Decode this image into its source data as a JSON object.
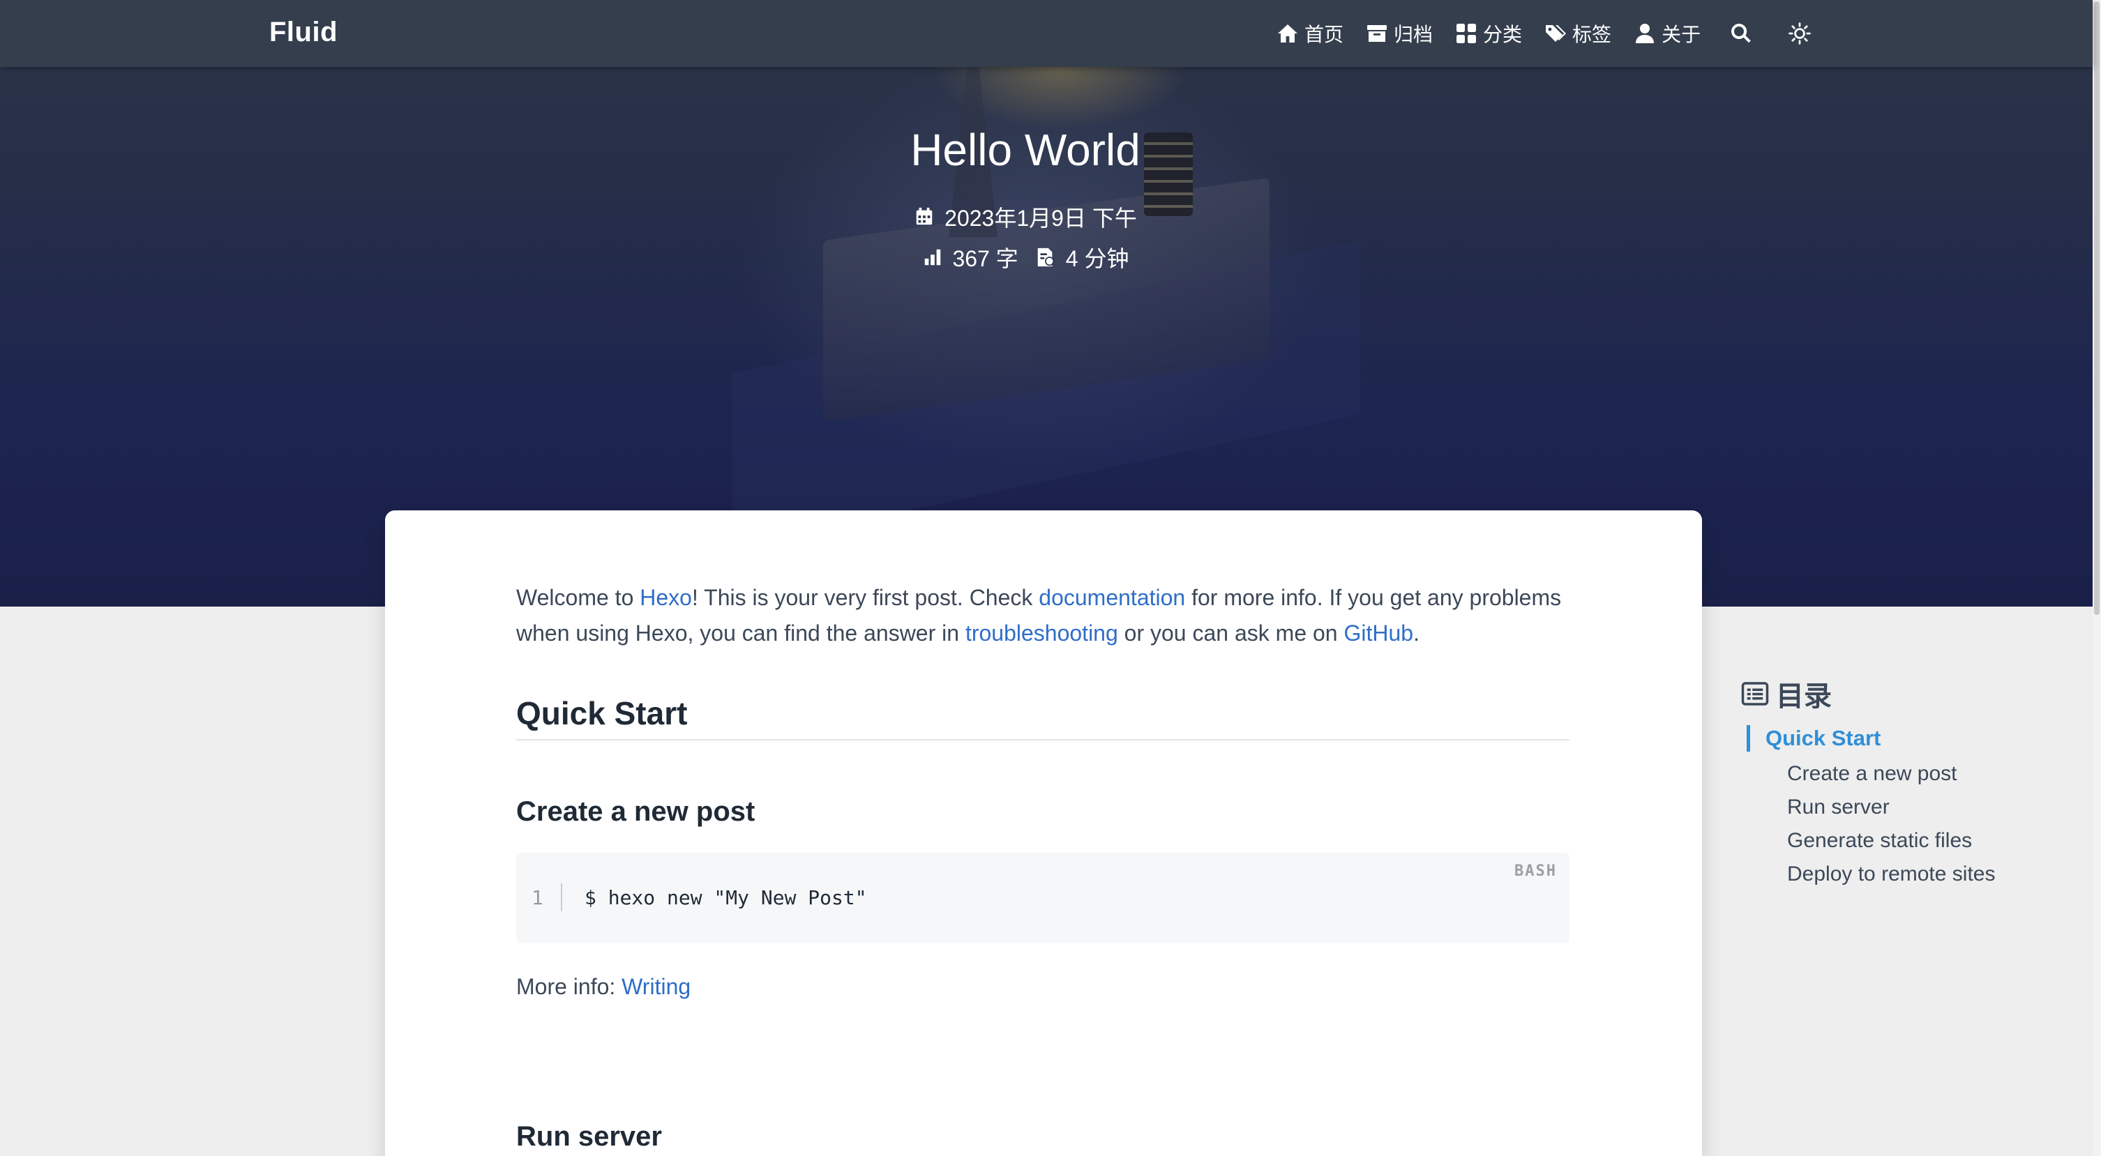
{
  "navbar": {
    "brand": "Fluid",
    "items": [
      {
        "label": "首页",
        "icon": "home-icon"
      },
      {
        "label": "归档",
        "icon": "archive-icon"
      },
      {
        "label": "分类",
        "icon": "category-icon"
      },
      {
        "label": "标签",
        "icon": "tags-icon"
      },
      {
        "label": "关于",
        "icon": "user-icon"
      }
    ],
    "search_icon": "search-icon",
    "theme_icon": "sun-icon"
  },
  "post": {
    "title": "Hello World",
    "date": "2023年1月9日 下午",
    "word_count": "367 字",
    "read_time": "4 分钟"
  },
  "content": {
    "intro": {
      "t1": "Welcome to ",
      "l1": "Hexo",
      "t2": "! This is your very first post. Check ",
      "l2": "documentation",
      "t3": " for more info. If you get any problems when using Hexo, you can find the answer in ",
      "l3": "troubleshooting",
      "t4": " or you can ask me on ",
      "l4": "GitHub",
      "t5": "."
    },
    "h_quick_start": "Quick Start",
    "h_create_post": "Create a new post",
    "code": {
      "lang": "BASH",
      "line_no": "1",
      "text": "$ hexo new \"My New Post\""
    },
    "more_info_label": "More info: ",
    "more_info_link": "Writing",
    "h_run_server": "Run server"
  },
  "toc": {
    "title": "目录",
    "active": "Quick Start",
    "items": [
      "Create a new post",
      "Run server",
      "Generate static files",
      "Deploy to remote sites"
    ]
  },
  "colors": {
    "navbar": "#343e4d",
    "link": "#2f6ec8",
    "toc_active": "#2f8fd8"
  }
}
